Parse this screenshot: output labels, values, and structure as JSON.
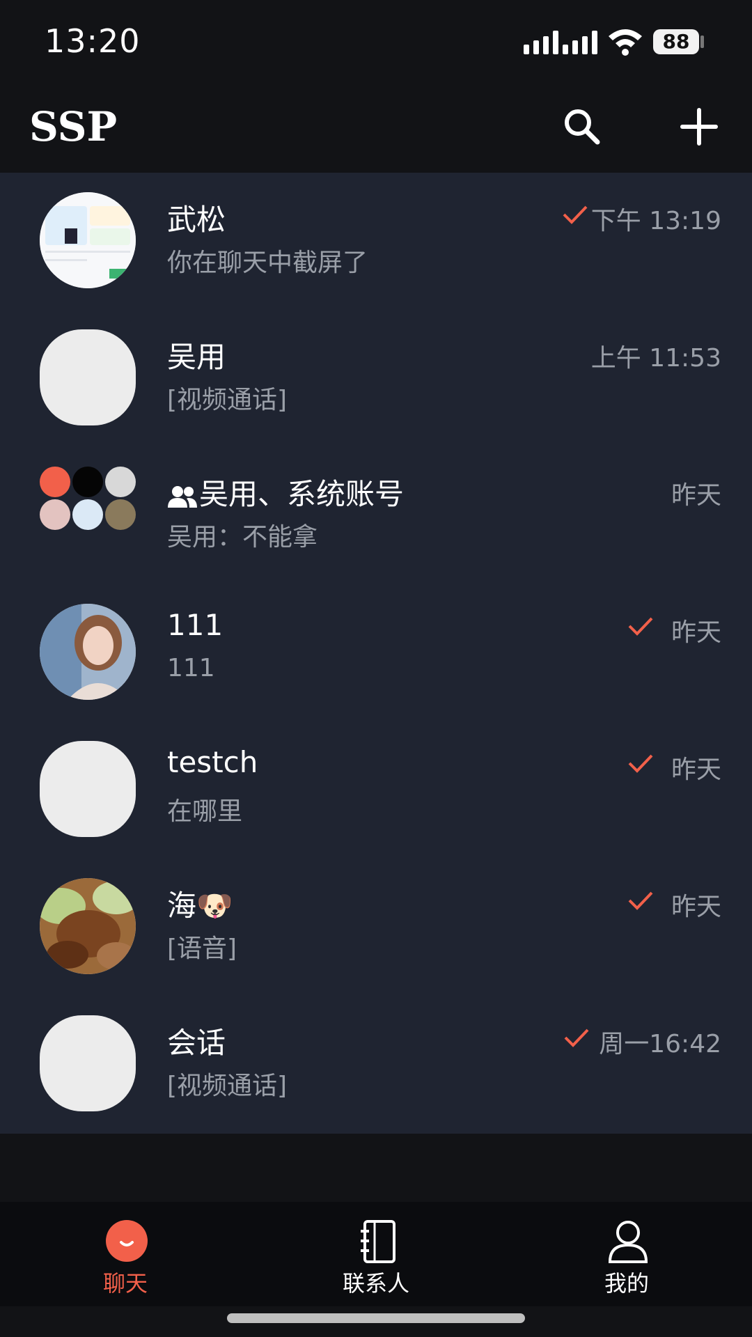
{
  "status_bar": {
    "time": "13:20",
    "battery": "88"
  },
  "header": {
    "title": "SSP"
  },
  "chats": [
    {
      "name": "武松",
      "preview": "你在聊天中截屏了",
      "time": "下午 13:19",
      "read": true,
      "avatar": "app-screenshot"
    },
    {
      "name": "吴用",
      "preview": "[视频通话]",
      "time": "上午 11:53",
      "read": false,
      "avatar": "blank"
    },
    {
      "name": "吴用、系统账号",
      "preview": "吴用：不能拿",
      "time": "昨天",
      "read": false,
      "avatar": "group-grid",
      "is_group": true
    },
    {
      "name": "111",
      "preview": "111",
      "time": "昨天",
      "read": true,
      "avatar": "photo-woman"
    },
    {
      "name": "testch",
      "preview": "在哪里",
      "time": "昨天",
      "read": true,
      "avatar": "blank"
    },
    {
      "name": "海🐶",
      "preview": "[语音]",
      "time": "昨天",
      "read": true,
      "avatar": "photo-food"
    },
    {
      "name": "会话",
      "preview": "[视频通话]",
      "time": "周一16:42",
      "read": true,
      "avatar": "blank"
    }
  ],
  "tabs": [
    {
      "label": "聊天",
      "active": true,
      "icon": "chat-bubble-icon"
    },
    {
      "label": "联系人",
      "active": false,
      "icon": "address-book-icon"
    },
    {
      "label": "我的",
      "active": false,
      "icon": "person-icon"
    }
  ],
  "colors": {
    "accent": "#f2604a",
    "list_bg": "#1f2431",
    "app_bg": "#121316"
  }
}
